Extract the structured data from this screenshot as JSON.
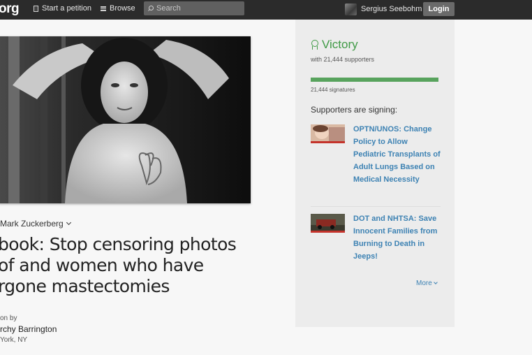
{
  "header": {
    "brand": "org",
    "start_petition": "Start a petition",
    "browse": "Browse",
    "search_placeholder": "Search",
    "user_name": "Sergius Seebohm",
    "login": "Login"
  },
  "petition": {
    "target": "Mark Zuckerberg",
    "title": "book: Stop censoring photos of and women who have rgone mastectomies",
    "started_by_label": "on by",
    "starter": "rchy Barrington",
    "location": "York, NY"
  },
  "sidebar": {
    "status": "Victory",
    "with_supporters": "with 21,444 supporters",
    "progress_fraction": 1.0,
    "signatures": "21,444 signatures",
    "signing_heading": "Supporters are signing:",
    "related": [
      {
        "title": "OPTN/UNOS: Change Policy to Allow Pediatric Transplants of Adult Lungs Based on Medical Necessity"
      },
      {
        "title": "DOT and NHTSA: Save Innocent Families from Burning to Death in Jeeps!"
      }
    ],
    "more": "More"
  },
  "colors": {
    "topbar": "#2b2b2b",
    "victory_green": "#3f9a45",
    "link_blue": "#3d82b3",
    "progress_green": "#58a35d"
  }
}
